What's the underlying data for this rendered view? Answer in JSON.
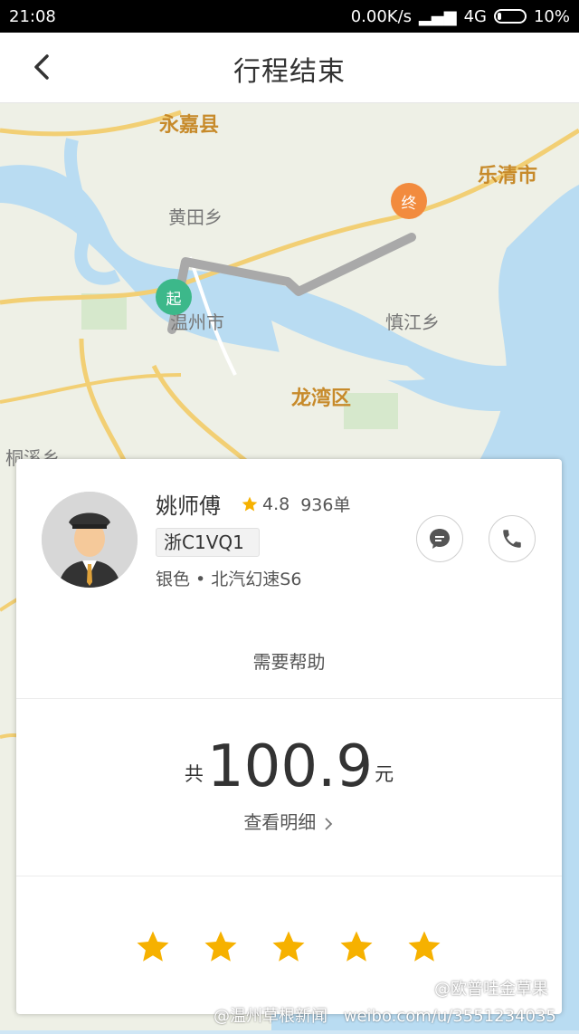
{
  "status_bar": {
    "time": "21:08",
    "speed": "0.00K/s",
    "network": "4G",
    "battery": "10%"
  },
  "nav": {
    "title": "行程结束"
  },
  "map": {
    "labels": {
      "yongjia": "永嘉县",
      "yueqing": "乐清市",
      "huangtian": "黄田乡",
      "wenzhou": "温州市",
      "qinjiang": "慎江乡",
      "longwan": "龙湾区",
      "tongxi": "桐溪乡"
    },
    "start_pin": "起",
    "end_pin": "终"
  },
  "driver": {
    "name": "姚师傅",
    "rating": "4.8",
    "orders": "936单",
    "plate": "浙C1VQ1",
    "car": "银色 • 北汽幻速S6"
  },
  "help": {
    "label": "需要帮助"
  },
  "fare": {
    "prefix": "共",
    "amount": "100.9",
    "unit": "元",
    "detail_label": "查看明细"
  },
  "rating_stars": {
    "count": 5,
    "color": "#f6b100"
  },
  "colors": {
    "accent": "#f6b100",
    "start": "#3cb88a",
    "end": "#f28b3e",
    "route": "#a9a9a9"
  },
  "watermark": {
    "weibo": "@欧普哇金草果",
    "source": "@温州草根新闻",
    "url": "weibo.com/u/3551234035"
  }
}
